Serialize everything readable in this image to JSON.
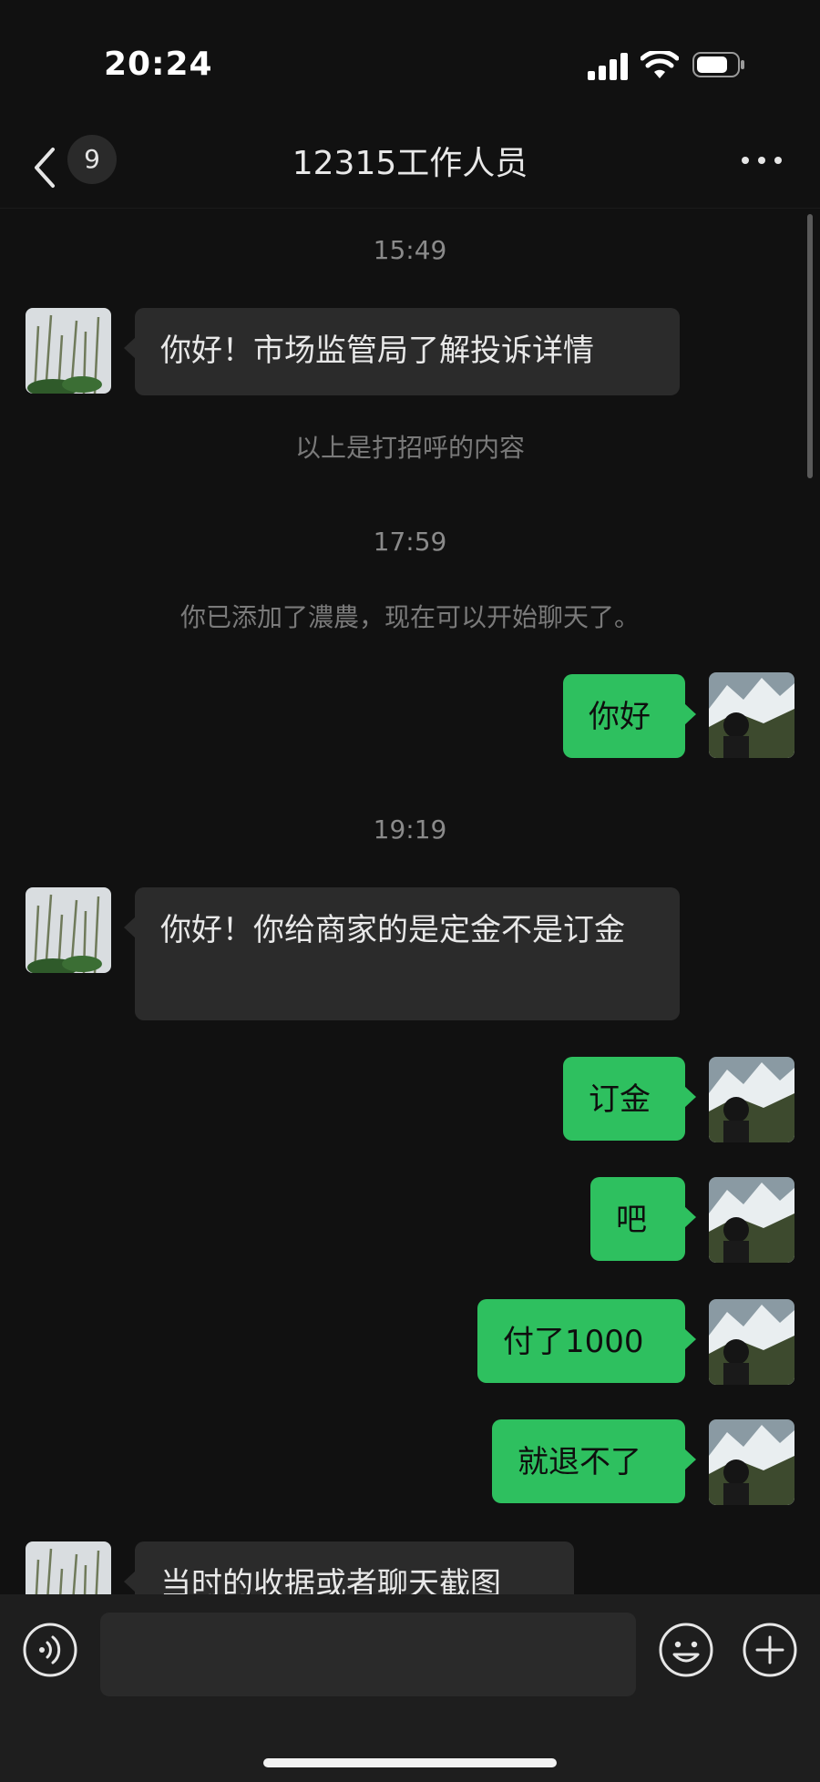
{
  "status_bar": {
    "time": "20:24"
  },
  "nav": {
    "back_badge": "9",
    "title": "12315工作人员"
  },
  "chat": {
    "ts1": "15:49",
    "msg1": "你好！市场监管局了解投诉详情",
    "sys1": "以上是打招呼的内容",
    "ts2": "17:59",
    "sys2": "你已添加了濃農，现在可以开始聊天了。",
    "out1": "你好",
    "ts3": "19:19",
    "msg2": "你好！你给商家的是定金不是订金",
    "out2": "订金",
    "out3": "吧",
    "out4": "付了1000",
    "out5": "就退不了",
    "msg3": "当时的收据或者聊天截图"
  },
  "colors": {
    "background": "#111111",
    "incoming_bubble": "#2b2b2b",
    "outgoing_bubble": "#2ec05f"
  },
  "icons": [
    "back-chevron-icon",
    "more-icon",
    "voice-icon",
    "emoji-icon",
    "plus-icon",
    "signal-icon",
    "wifi-icon",
    "battery-icon"
  ]
}
